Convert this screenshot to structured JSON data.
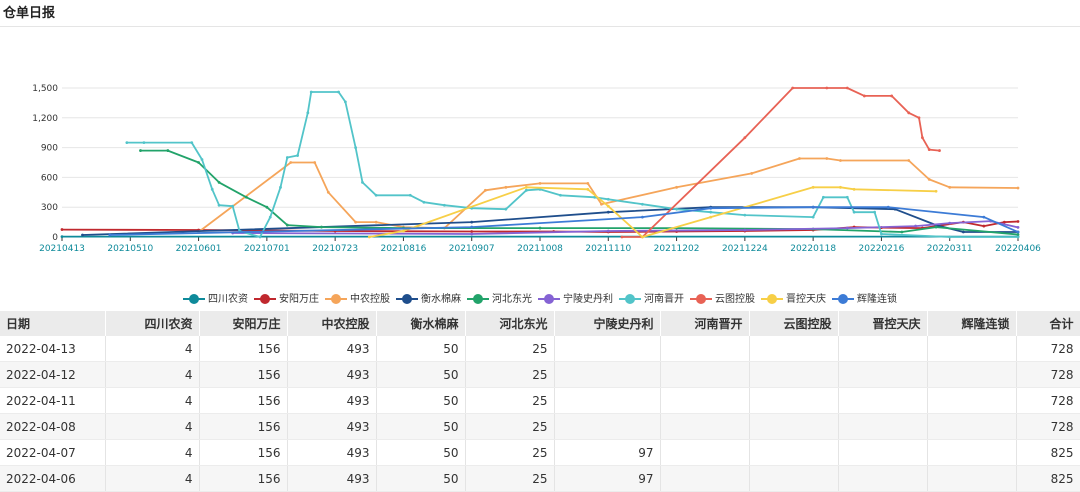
{
  "page": {
    "title": "仓单日报"
  },
  "chart_data": {
    "type": "line",
    "x": [
      "20210413",
      "20210510",
      "20210601",
      "20210701",
      "20210723",
      "20210816",
      "20210907",
      "20211008",
      "20211110",
      "20211202",
      "20211224",
      "20220118",
      "20220216",
      "20220311",
      "20220406"
    ],
    "ylim": [
      0,
      1500
    ],
    "yticks": [
      "0",
      "300",
      "600",
      "900",
      "1,200",
      "1,500"
    ],
    "grid": "horizontal",
    "legend_position": "bottom",
    "series": [
      {
        "name": "四川农资",
        "color": "#0e8a9a",
        "points": [
          [
            0,
            4
          ],
          [
            14,
            4
          ]
        ]
      },
      {
        "name": "安阳万庄",
        "color": "#c0282e",
        "points": [
          [
            0,
            75
          ],
          [
            2,
            70
          ],
          [
            4,
            60
          ],
          [
            6,
            55
          ],
          [
            7.2,
            55
          ],
          [
            8,
            50
          ],
          [
            9,
            55
          ],
          [
            10,
            60
          ],
          [
            11,
            70
          ],
          [
            11.6,
            100
          ],
          [
            12,
            95
          ],
          [
            12.6,
            90
          ],
          [
            13.2,
            150
          ],
          [
            13.5,
            110
          ],
          [
            13.8,
            150
          ],
          [
            14,
            156
          ]
        ]
      },
      {
        "name": "中农控股",
        "color": "#f5a55a",
        "points": [
          [
            2,
            50
          ],
          [
            3.35,
            750
          ],
          [
            3.7,
            750
          ],
          [
            3.9,
            450
          ],
          [
            4.3,
            150
          ],
          [
            4.6,
            150
          ],
          [
            5,
            100
          ],
          [
            5.6,
            90
          ],
          [
            6.2,
            470
          ],
          [
            6.5,
            500
          ],
          [
            7,
            540
          ],
          [
            7.7,
            540
          ],
          [
            7.9,
            330
          ],
          [
            9,
            500
          ],
          [
            10.1,
            640
          ],
          [
            10.8,
            790
          ],
          [
            11.2,
            790
          ],
          [
            11.4,
            770
          ],
          [
            12.4,
            770
          ],
          [
            12.7,
            580
          ],
          [
            13,
            500
          ],
          [
            14,
            493
          ]
        ]
      },
      {
        "name": "衡水棉麻",
        "color": "#1f4e8c",
        "points": [
          [
            0.3,
            20
          ],
          [
            6,
            150
          ],
          [
            8,
            250
          ],
          [
            9.5,
            300
          ],
          [
            11,
            300
          ],
          [
            12.2,
            280
          ],
          [
            12.8,
            120
          ],
          [
            13.2,
            50
          ],
          [
            14,
            50
          ]
        ]
      },
      {
        "name": "河北东光",
        "color": "#22a36a",
        "points": [
          [
            1.15,
            870
          ],
          [
            1.55,
            870
          ],
          [
            2,
            750
          ],
          [
            2.3,
            550
          ],
          [
            2.7,
            400
          ],
          [
            3,
            300
          ],
          [
            3.3,
            120
          ],
          [
            3.8,
            100
          ],
          [
            5,
            90
          ],
          [
            7,
            90
          ],
          [
            9,
            90
          ],
          [
            11,
            80
          ],
          [
            12.3,
            50
          ],
          [
            12.8,
            100
          ],
          [
            14,
            25
          ]
        ]
      },
      {
        "name": "宁陵史丹利",
        "color": "#8563d4",
        "points": [
          [
            2.5,
            40
          ],
          [
            6,
            30
          ],
          [
            8,
            60
          ],
          [
            10,
            70
          ],
          [
            11.5,
            90
          ],
          [
            12.5,
            110
          ],
          [
            13,
            140
          ],
          [
            13.6,
            160
          ],
          [
            14,
            97
          ]
        ]
      },
      {
        "name": "河南晋开",
        "color": "#52c4c9",
        "points": [
          [
            0.95,
            950
          ],
          [
            1.2,
            950
          ],
          [
            1.9,
            950
          ],
          [
            2.05,
            780
          ],
          [
            2.2,
            480
          ],
          [
            2.3,
            320
          ],
          [
            2.5,
            310
          ],
          [
            2.6,
            60
          ],
          [
            2.9,
            0
          ],
          [
            3.05,
            200
          ],
          [
            3.2,
            500
          ],
          [
            3.3,
            800
          ],
          [
            3.45,
            820
          ],
          [
            3.6,
            1250
          ],
          [
            3.65,
            1460
          ],
          [
            4.05,
            1460
          ],
          [
            4.15,
            1360
          ],
          [
            4.3,
            900
          ],
          [
            4.4,
            550
          ],
          [
            4.6,
            420
          ],
          [
            5.1,
            420
          ],
          [
            5.3,
            350
          ],
          [
            5.6,
            320
          ],
          [
            6,
            290
          ],
          [
            6.5,
            280
          ],
          [
            6.8,
            470
          ],
          [
            7,
            480
          ],
          [
            7.3,
            420
          ],
          [
            7.8,
            400
          ],
          [
            8,
            380
          ],
          [
            8.5,
            330
          ],
          [
            9,
            280
          ],
          [
            9.5,
            250
          ],
          [
            10,
            220
          ],
          [
            11,
            200
          ],
          [
            11.15,
            400
          ],
          [
            11.5,
            400
          ],
          [
            11.6,
            250
          ],
          [
            11.9,
            250
          ],
          [
            12,
            30
          ],
          [
            13,
            0
          ],
          [
            14,
            0
          ]
        ]
      },
      {
        "name": "云图控股",
        "color": "#e86255",
        "points": [
          [
            8.2,
            0
          ],
          [
            8.5,
            0
          ],
          [
            10,
            1000
          ],
          [
            10.7,
            1500
          ],
          [
            11.2,
            1500
          ],
          [
            11.5,
            1500
          ],
          [
            11.75,
            1420
          ],
          [
            12.15,
            1420
          ],
          [
            12.4,
            1250
          ],
          [
            12.55,
            1200
          ],
          [
            12.6,
            1000
          ],
          [
            12.7,
            880
          ],
          [
            12.85,
            870
          ]
        ]
      },
      {
        "name": "晋控天庆",
        "color": "#f7cf47",
        "points": [
          [
            4.5,
            0
          ],
          [
            5,
            60
          ],
          [
            6.8,
            500
          ],
          [
            7.7,
            480
          ],
          [
            8,
            310
          ],
          [
            8.5,
            0
          ],
          [
            9.5,
            200
          ],
          [
            11,
            500
          ],
          [
            11.4,
            500
          ],
          [
            11.6,
            480
          ],
          [
            12.8,
            460
          ]
        ]
      },
      {
        "name": "辉隆连锁",
        "color": "#3c7bd6",
        "points": [
          [
            0.7,
            20
          ],
          [
            6,
            100
          ],
          [
            8.5,
            200
          ],
          [
            9.5,
            290
          ],
          [
            11,
            300
          ],
          [
            12.1,
            300
          ],
          [
            13.5,
            200
          ],
          [
            14,
            50
          ]
        ]
      }
    ]
  },
  "table": {
    "headers": [
      "日期",
      "四川农资",
      "安阳万庄",
      "中农控股",
      "衡水棉麻",
      "河北东光",
      "宁陵史丹利",
      "河南晋开",
      "云图控股",
      "晋控天庆",
      "辉隆连锁",
      "合计"
    ],
    "rows": [
      [
        "2022-04-13",
        "4",
        "156",
        "493",
        "50",
        "25",
        "",
        "",
        "",
        "",
        "",
        "728"
      ],
      [
        "2022-04-12",
        "4",
        "156",
        "493",
        "50",
        "25",
        "",
        "",
        "",
        "",
        "",
        "728"
      ],
      [
        "2022-04-11",
        "4",
        "156",
        "493",
        "50",
        "25",
        "",
        "",
        "",
        "",
        "",
        "728"
      ],
      [
        "2022-04-08",
        "4",
        "156",
        "493",
        "50",
        "25",
        "",
        "",
        "",
        "",
        "",
        "728"
      ],
      [
        "2022-04-07",
        "4",
        "156",
        "493",
        "50",
        "25",
        "97",
        "",
        "",
        "",
        "",
        "825"
      ],
      [
        "2022-04-06",
        "4",
        "156",
        "493",
        "50",
        "25",
        "97",
        "",
        "",
        "",
        "",
        "825"
      ]
    ]
  }
}
